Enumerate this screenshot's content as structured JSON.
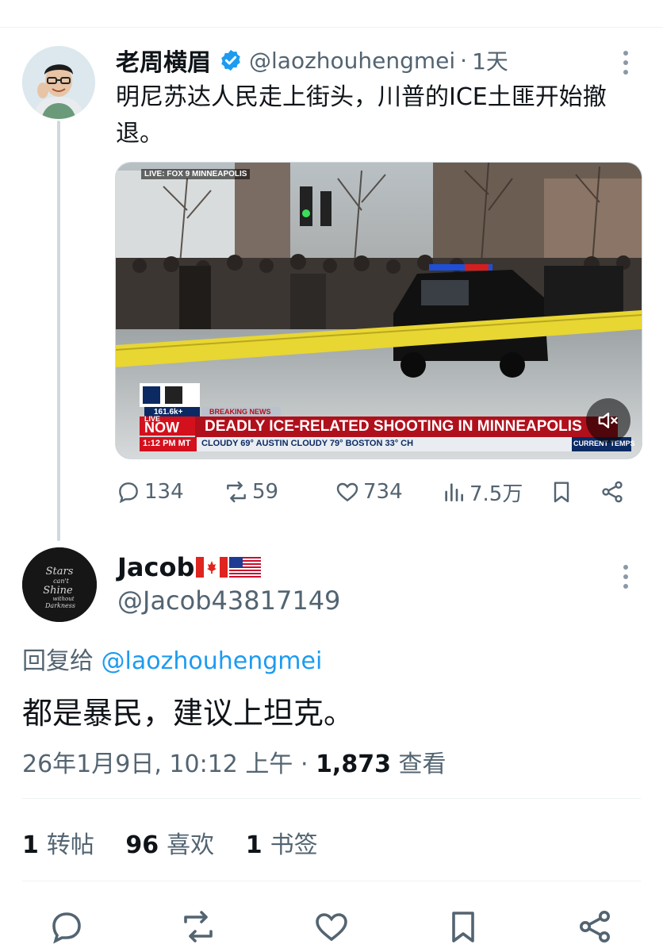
{
  "parent_tweet": {
    "author_name": "老周横眉",
    "handle": "@laozhouhengmei",
    "separator": "·",
    "time": "1天",
    "text": "明尼苏达人民走上街头，川普的ICE土匪开始撤退。",
    "media": {
      "live_bug": "LIVE: FOX 9 MINNEAPOLIS",
      "viewer_count": "161.6k+",
      "breaking_label": "BREAKING NEWS",
      "live_label": "LIVE",
      "now_label": "NOW",
      "headline": "DEADLY ICE-RELATED SHOOTING IN MINNEAPOLIS",
      "clock": "1:12 PM MT",
      "ticker": "CLOUDY 69°   AUSTIN CLOUDY 79°   BOSTON 33°   CH",
      "ticker_tag": "CURRENT TEMPS",
      "mute_icon": "speaker-muted-icon"
    },
    "stats": {
      "replies": "134",
      "reposts": "59",
      "likes": "734",
      "views": "7.5万"
    }
  },
  "reply_tweet": {
    "author_name": "Jacob",
    "flags": [
      "canada-flag",
      "usa-flag"
    ],
    "avatar_text": [
      "Stars",
      "can't",
      "Shine",
      "without",
      "Darkness"
    ],
    "handle": "@Jacob43817149",
    "reply_to_label": "回复给",
    "reply_to_handle": "@laozhouhengmei",
    "text": "都是暴民，建议上坦克。",
    "timestamp": "26年1月9日, 10:12 上午",
    "meta_separator": "·",
    "view_count": "1,873",
    "view_label": "查看",
    "reposts_count": "1",
    "reposts_label": "转帖",
    "likes_count": "96",
    "likes_label": "喜欢",
    "bookmarks_count": "1",
    "bookmarks_label": "书签"
  },
  "colors": {
    "accent": "#1d9bf0",
    "secondary_text": "#536471",
    "primary_text": "#0f1419"
  }
}
